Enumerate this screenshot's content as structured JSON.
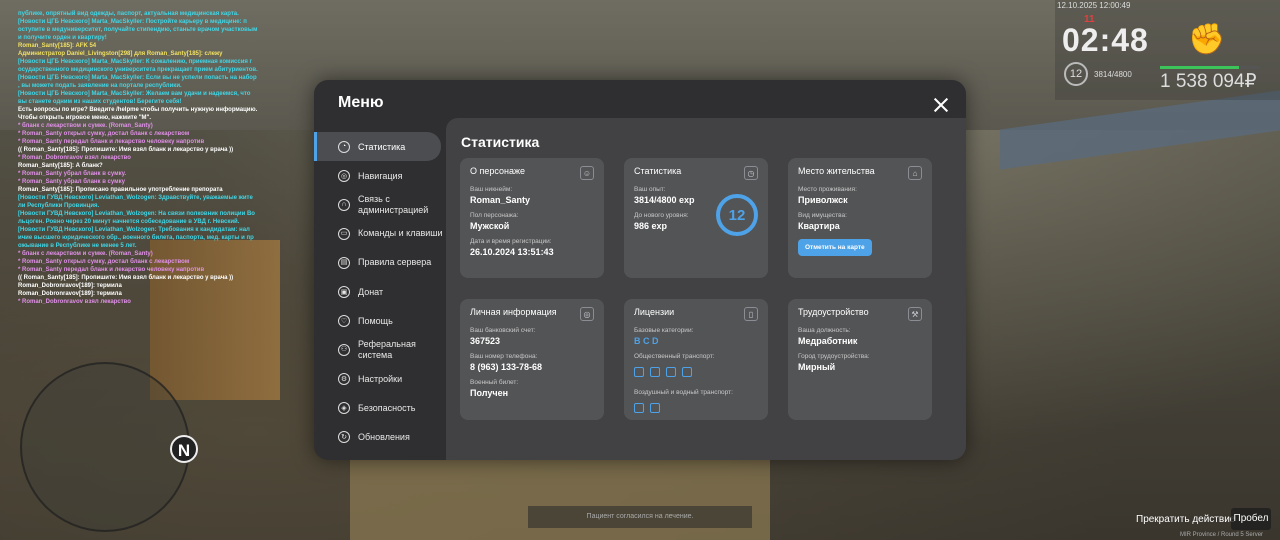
{
  "chat": [
    {
      "t": "публике, опрятный вид одежды, паспорт, актуальная медицинская карта.",
      "c": "c-cyan"
    },
    {
      "t": "[Новости ЦГБ Невского] Marta_MacSkyller: Постройте карьеру в медицине: п",
      "c": "c-cyan"
    },
    {
      "t": "оступите в медуниверситет, получайте стипендию, станьте врачом участковым",
      "c": "c-cyan"
    },
    {
      "t": "и получите орден и квартиру!",
      "c": "c-cyan"
    },
    {
      "t": "Roman_Santy[185]: AFK 54",
      "c": "c-yellow"
    },
    {
      "t": "Администратор Daniel_Livingston[298] для Roman_Santy[185]: слежу",
      "c": "c-yellow"
    },
    {
      "t": "[Новости ЦГБ Невского] Marta_MacSkyller: К сожалению, приемная комиссия г",
      "c": "c-cyan"
    },
    {
      "t": "осударственного медицинского университета прекращает прием абитуриентов.",
      "c": "c-cyan"
    },
    {
      "t": "[Новости ЦГБ Невского] Marta_MacSkyller: Если вы не успели попасть на набор",
      "c": "c-cyan"
    },
    {
      "t": ", вы можете подать заявление на портале республики.",
      "c": "c-cyan"
    },
    {
      "t": "[Новости ЦГБ Невского] Marta_MacSkyller: Желаем вам удачи и надеемся, что",
      "c": "c-cyan"
    },
    {
      "t": "вы станете одним из наших студентов! Берегите себя!",
      "c": "c-cyan"
    },
    {
      "t": "Есть вопросы по игре? Введите /helpme чтобы получить нужную информацию.",
      "c": "c-white"
    },
    {
      "t": "Чтобы открыть игровое меню, нажмите \"M\".",
      "c": "c-white"
    },
    {
      "t": "* бланк с лекарством и сумке. (Roman_Santy)",
      "c": "c-pink"
    },
    {
      "t": "* Roman_Santy открыл сумку, достал бланк с лекарством",
      "c": "c-pink"
    },
    {
      "t": "* Roman_Santy передал бланк и лекарство человеку напротив",
      "c": "c-pink"
    },
    {
      "t": "(( Roman_Santy[185]: Пропишите: Имя взял бланк и лекарство у врача ))",
      "c": "c-white"
    },
    {
      "t": "* Roman_Dobronravov взял лекарство",
      "c": "c-pink"
    },
    {
      "t": "Roman_Santy[185]: А бланк?",
      "c": "c-white"
    },
    {
      "t": "* Roman_Santy убрал бланк в сумку.",
      "c": "c-pink"
    },
    {
      "t": "* Roman_Santy убрал бланк в сумку",
      "c": "c-pink"
    },
    {
      "t": "Roman_Santy[185]: Прописано правильное употребление препората",
      "c": "c-white"
    },
    {
      "t": "[Новости ГУВД Невского] Leviathan_Wolzogen: Здравствуйте, уважаемые жите",
      "c": "c-cyan"
    },
    {
      "t": "ли Республики Провинция.",
      "c": "c-cyan"
    },
    {
      "t": "[Новости ГУВД Невского] Leviathan_Wolzogen: На связи полковник полиции Во",
      "c": "c-cyan"
    },
    {
      "t": "льцоген. Ровно через 20 минут начнется собеседование в УВД г. Невский.",
      "c": "c-cyan"
    },
    {
      "t": "[Новости ГУВД Невского] Leviathan_Wolzogen: Требования к кандидатам: нал",
      "c": "c-cyan"
    },
    {
      "t": "ичие высшего юридического обр., военного билета, паспорта, мед. карты и пр",
      "c": "c-cyan"
    },
    {
      "t": "ожывание в Республике не менее 5 лет.",
      "c": "c-cyan"
    },
    {
      "t": "* бланк с лекарством и сумке. (Roman_Santy)",
      "c": "c-pink"
    },
    {
      "t": "* Roman_Santy открыл сумку, достал бланк с лекарством",
      "c": "c-pink"
    },
    {
      "t": "* Roman_Santy передал бланк и лекарство человеку напротив",
      "c": "c-pink"
    },
    {
      "t": "(( Roman_Santy[185]: Пропишите: Имя взял бланк и лекарство у врача ))",
      "c": "c-white"
    },
    {
      "t": "Roman_Dobronravov[189]: термила",
      "c": "c-white"
    },
    {
      "t": "Roman_Dobronravov[189]: термила",
      "c": "c-white"
    },
    {
      "t": "* Roman_Dobronravov взял лекарство",
      "c": "c-pink"
    }
  ],
  "hud": {
    "date": "12.10.2025 12:00:49",
    "time": "02:48",
    "counter": "11",
    "level": "12",
    "exp": "3814/4800",
    "exp_progress": 0.79,
    "money": "1 538 094₽"
  },
  "compass": "N",
  "notice": "Пациент согласился на лечение.",
  "stop_action": "Прекратить действие",
  "space_key": "Пробел",
  "watermark": "MIR Province / Round 5 Server",
  "modal": {
    "title": "Меню",
    "nav": [
      {
        "label": "Статистика",
        "icon": "chart-icon",
        "active": true
      },
      {
        "label": "Навигация",
        "icon": "compass-icon"
      },
      {
        "label": "Связь с администрацией",
        "icon": "headset-icon"
      },
      {
        "label": "Команды и клавиши",
        "icon": "keyboard-icon"
      },
      {
        "label": "Правила сервера",
        "icon": "book-icon"
      },
      {
        "label": "Донат",
        "icon": "wallet-icon"
      },
      {
        "label": "Помощь",
        "icon": "heart-icon"
      },
      {
        "label": "Реферальная система",
        "icon": "referral-icon"
      },
      {
        "label": "Настройки",
        "icon": "gear-icon"
      },
      {
        "label": "Безопасность",
        "icon": "shield-icon"
      },
      {
        "label": "Обновления",
        "icon": "refresh-icon"
      }
    ],
    "content_title": "Статистика",
    "personal": {
      "title": "О персонаже",
      "nick_label": "Ваш никнейм:",
      "nick": "Roman_Santy",
      "sex_label": "Пол персонажа:",
      "sex": "Мужской",
      "reg_label": "Дата и время регистрации:",
      "reg": "26.10.2024 13:51:43"
    },
    "stats": {
      "title": "Статистика",
      "exp_label": "Ваш опыт:",
      "exp": "3814/4800 exp",
      "next_label": "До нового уровня:",
      "next": "986 exp",
      "level": "12"
    },
    "residence": {
      "title": "Место жительства",
      "place_label": "Место проживания:",
      "place": "Приволжск",
      "prop_label": "Вид имущества:",
      "prop": "Квартира",
      "map_button": "Отметить на карте"
    },
    "info": {
      "title": "Личная информация",
      "bank_label": "Ваш банковский счет:",
      "bank": "367523",
      "phone_label": "Ваш номер телефона:",
      "phone": "8 (963) 133-78-68",
      "mil_label": "Военный билет:",
      "mil": "Получен"
    },
    "licenses": {
      "title": "Лицензии",
      "base_label": "Базовые категории:",
      "base": "B  C  D",
      "public_label": "Общественный транспорт:",
      "air_label": "Воздушный и водный транспорт:"
    },
    "job": {
      "title": "Трудоустройство",
      "pos_label": "Ваша должность:",
      "pos": "Медработник",
      "city_label": "Город трудоустройства:",
      "city": "Мирный"
    }
  }
}
